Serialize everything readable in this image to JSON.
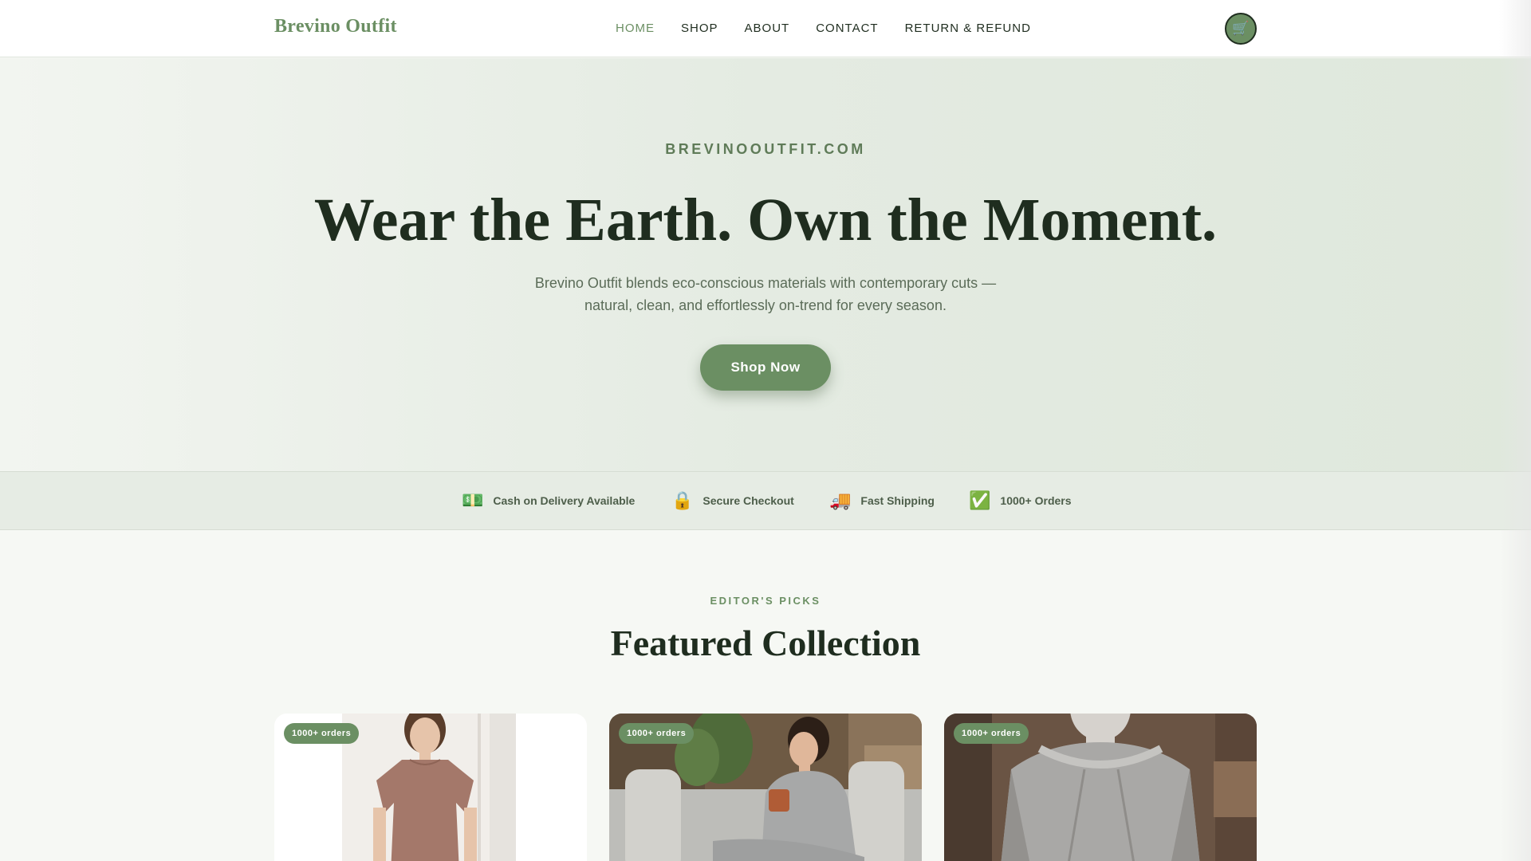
{
  "brand": {
    "logo": "Brevino Outfit",
    "accent": "#6b8f63",
    "dark": "#1f2d1f"
  },
  "nav": {
    "items": [
      {
        "label": "HOME",
        "active": true
      },
      {
        "label": "SHOP"
      },
      {
        "label": "ABOUT"
      },
      {
        "label": "CONTACT"
      },
      {
        "label": "RETURN & REFUND"
      }
    ],
    "cart_icon": "cart-icon"
  },
  "hero": {
    "eyebrow": "BREVINOOUTFIT.COM",
    "title": "Wear the Earth. Own the Moment.",
    "subtitle": "Brevino Outfit blends eco-conscious materials with contemporary cuts — natural, clean, and effortlessly on-trend for every season.",
    "cta": "Shop Now"
  },
  "trust": {
    "items": [
      {
        "icon": "cash-icon",
        "glyph": "💵",
        "label": "Cash on Delivery Available"
      },
      {
        "icon": "lock-icon",
        "glyph": "🔒",
        "label": "Secure Checkout"
      },
      {
        "icon": "truck-icon",
        "glyph": "🚚",
        "label": "Fast Shipping"
      },
      {
        "icon": "check-icon",
        "glyph": "✅",
        "label": "1000+ Orders"
      }
    ]
  },
  "featured": {
    "eyebrow": "EDITOR'S PICKS",
    "title": "Featured Collection",
    "products": [
      {
        "badge": "1000+ orders"
      },
      {
        "badge": "1000+ orders"
      },
      {
        "badge": "1000+ orders"
      }
    ]
  }
}
